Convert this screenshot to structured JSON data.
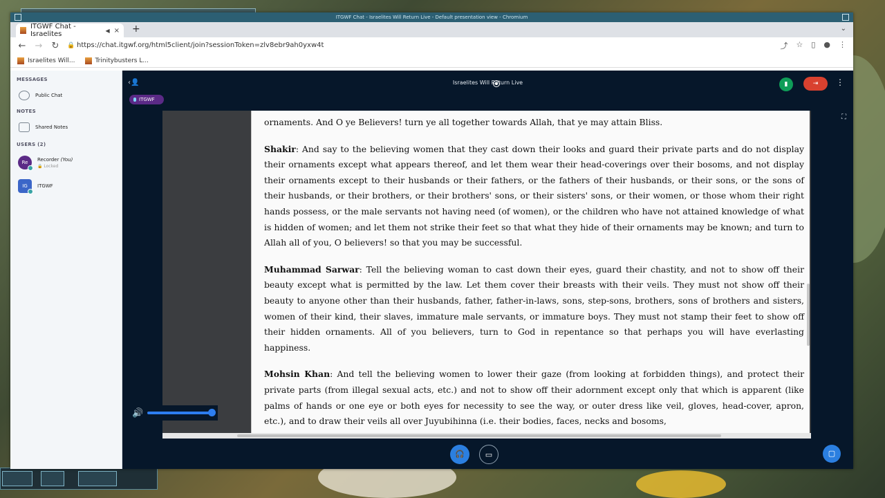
{
  "os": {
    "window_title": "ITGWF Chat - Israelites Will Return Live - Default presentation view - Chromium"
  },
  "browser": {
    "tab_title": "ITGWF Chat - Israelites",
    "tab_close": "×",
    "new_tab": "+",
    "tab_menu": "⌄",
    "url": "https://chat.itgwf.org/html5client/join?sessionToken=zlv8ebr9ah0yxw4t",
    "bookmarks": [
      "Israelites Will...",
      "Trinitybusters L..."
    ]
  },
  "sidebar": {
    "messages_title": "MESSAGES",
    "public_chat": "Public Chat",
    "notes_title": "NOTES",
    "shared_notes": "Shared Notes",
    "users_title": "USERS (2)",
    "users": [
      {
        "initials": "Re",
        "name": "Recorder",
        "you": "(You)",
        "status": "🔒 Locked",
        "color": "#5b2a86"
      },
      {
        "initials": "IG",
        "name": "ITGWF",
        "color": "#3b66c8"
      }
    ]
  },
  "header": {
    "title": "Israelites Will Return Live",
    "talking_user": "ITGWF"
  },
  "slide": {
    "paragraphs": [
      {
        "name": "",
        "text": "ornaments. And O ye Believers! turn ye all together towards Allah, that ye may attain Bliss."
      },
      {
        "name": "Shakir",
        "text": ": And say to the believing women that they cast down their looks and guard their private parts and do not display their ornaments except what appears thereof, and let them wear their head-coverings over their bosoms, and not display their ornaments except to their husbands or their fathers, or the fathers of their husbands, or their sons, or the sons of their husbands, or their brothers, or their brothers' sons, or their sisters' sons, or their women, or those whom their right hands possess, or the male servants not having need (of women), or the children who have not attained knowledge of what is hidden of women; and let them not strike their feet so that what they hide of their ornaments may be known; and turn to Allah all of you, O believers! so that you may be successful."
      },
      {
        "name": "Muhammad Sarwar",
        "text": ": Tell the believing woman to cast down their eyes, guard their chastity, and not to show off their beauty except what is permitted by the law. Let them cover their breasts with their veils. They must not show off their beauty to anyone other than their husbands, father, father-in-laws, sons, step-sons, brothers, sons of brothers and sisters, women of their kind, their slaves, immature male servants, or immature boys. They must not stamp their feet to show off their hidden ornaments. All of you believers, turn to God in repentance so that perhaps you will have everlasting happiness."
      },
      {
        "name": "Mohsin Khan",
        "text": ": And tell the believing women to lower their gaze (from looking at forbidden things), and protect their private parts (from illegal sexual acts, etc.) and not to show off their adornment except only that which is apparent (like palms of hands or one eye or both eyes for necessity to see the way, or outer dress like veil, gloves, head-cover, apron, etc.), and to draw their veils all over Juyubihinna (i.e. their bodies, faces, necks and bosoms,"
      }
    ]
  },
  "controls": {
    "volume_level": 1.0
  }
}
